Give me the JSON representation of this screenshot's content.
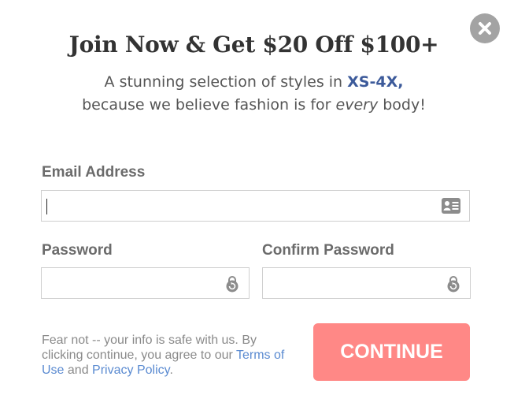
{
  "modal": {
    "headline": "Join Now & Get $20 Off $100+",
    "sub_line1_before": "A stunning selection of styles in ",
    "sub_line1_highlight": "XS-4X,",
    "sub_line2_before": "because we believe fashion is for ",
    "sub_line2_emphasis": "every",
    "sub_line2_after": " body!"
  },
  "form": {
    "email_label": "Email Address",
    "email_value": "",
    "password_label": "Password",
    "password_value": "",
    "confirm_label": "Confirm Password",
    "confirm_value": "",
    "continue_label": "CONTINUE"
  },
  "footer_note": {
    "text_before": "Fear not -- your info is safe with us. By clicking continue, you agree to our ",
    "terms_link": "Terms of Use",
    "and_text": " and ",
    "privacy_link": "Privacy Policy",
    "end_text": "."
  },
  "icons": {
    "close": "close-icon",
    "email_field": "contact-card-icon",
    "password_field": "lock-icon",
    "confirm_field": "lock-icon"
  },
  "colors": {
    "continue_button": "#ff8886",
    "highlight": "#3c5a9a",
    "link": "#5b8bd1",
    "close_button": "#a3a3a3"
  }
}
